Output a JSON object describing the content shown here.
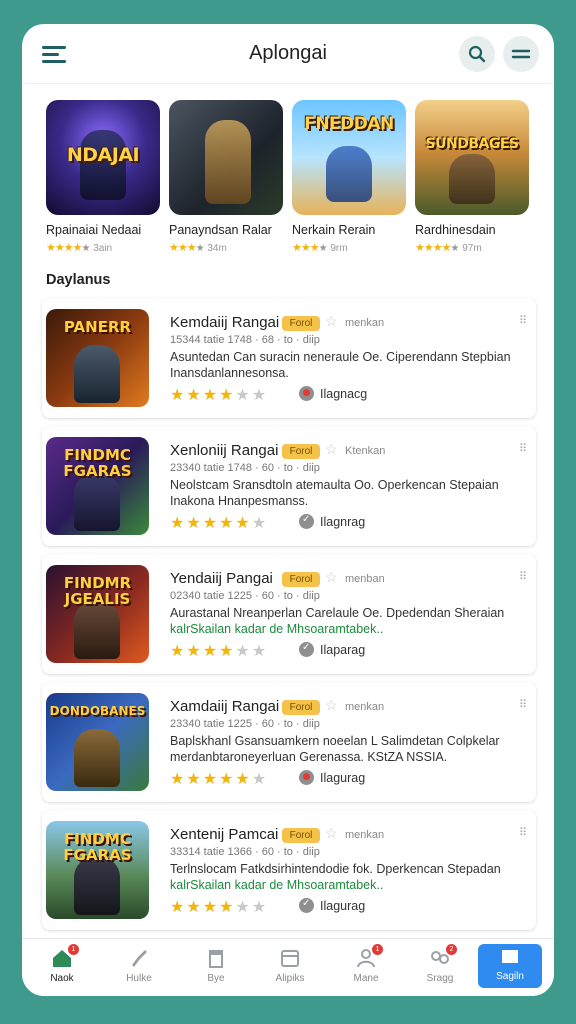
{
  "app": {
    "title": "Aplongai"
  },
  "featured": [
    {
      "name": "Rpainaiai Nedaai",
      "logo": "NDAJAI",
      "rating_text": "3ain",
      "stars": 4
    },
    {
      "name": "Panayndsan Ralar",
      "logo": "",
      "rating_text": "34m",
      "stars": 3
    },
    {
      "name": "Nerkain Rerain",
      "logo": "FNEDDAN",
      "rating_text": "9rm",
      "stars": 4
    },
    {
      "name": "Rardhinesdain",
      "logo": "SUNDBAGES",
      "rating_text": "97m",
      "stars": 4
    }
  ],
  "section": {
    "title": "Daylanus"
  },
  "apps": [
    {
      "name": "Kemdaiij Rangai",
      "logo": "PANERR",
      "badge": "Forol",
      "tag": "menkan",
      "meta": "15344 tatie 1748 · 68 · to · diip",
      "desc1": "Asuntedan Can suracin neneraule Oe. Ciperendann Stepbian",
      "desc2": "Inansdanlannesonsa.",
      "desc2_green": false,
      "stars": 4,
      "developer": "Ilagnacg",
      "dev_icon": "red"
    },
    {
      "name": "Xenloniij Rangai",
      "logo": "FINDMC FGARAS",
      "badge": "Forol",
      "tag": "Ktenkan",
      "meta": "23340 tatie 1748 · 60 · to · diip",
      "desc1": "Neolstcam Sransdtoln atemaulta Oo. Operkencan Stepaian",
      "desc2": "Inakona Hnanpesmanss.",
      "desc2_green": false,
      "stars": 5,
      "developer": "Ilagnrag",
      "dev_icon": "check"
    },
    {
      "name": "Yendaiij Pangai",
      "logo": "FINDMR JGEALIS",
      "badge": "Forol",
      "tag": "menban",
      "meta": "02340 tatie 1225 · 60 · to · diip",
      "desc1": "Aurastanal Nreanperlan Carelaule Oe. Dpedendan Sheraian",
      "desc2": "kalrSkailan kadar de Mhsoaramtabek..",
      "desc2_green": true,
      "stars": 4,
      "developer": "Ilaparag",
      "dev_icon": "check"
    },
    {
      "name": "Xamdaiij Rangai",
      "logo": "DONDOBANES",
      "badge": "Forol",
      "tag": "menkan",
      "meta": "23340 tatie 1225 · 60 · to · diip",
      "desc1": "Baplskhanl Gsansuamkern noeelan L Salimdetan Colpkelar",
      "desc2": "merdanbtaroneyerluan Gerenassa. KStZA NSSIA.",
      "desc2_green": false,
      "stars": 5,
      "developer": "Ilagurag",
      "dev_icon": "red"
    },
    {
      "name": "Xentenij Pamcai",
      "logo": "FINDMC FGARAS",
      "badge": "Forol",
      "tag": "menkan",
      "meta": "33314 tatie 1366 · 60 · to · diip",
      "desc1": "Terlnslocam Fatkdsirhintendodie fok. Dperkencan Stepadan",
      "desc2": "kalrSkailan kadar de Mhsoaramtabek..",
      "desc2_green": true,
      "stars": 4,
      "developer": "Ilagurag",
      "dev_icon": "check"
    }
  ],
  "nav": [
    {
      "label": "Naok",
      "icon": "home-icon",
      "badge": "1",
      "active": true
    },
    {
      "label": "Hulke",
      "icon": "rocket-icon",
      "badge": "",
      "active": false
    },
    {
      "label": "Bye",
      "icon": "trash-icon",
      "badge": "",
      "active": false
    },
    {
      "label": "Alipiks",
      "icon": "calendar-icon",
      "badge": "",
      "active": false
    },
    {
      "label": "Mane",
      "icon": "user-icon",
      "badge": "1",
      "active": false
    },
    {
      "label": "Sragg",
      "icon": "group-icon",
      "badge": "2",
      "active": false
    },
    {
      "label": "Sagiln",
      "icon": "square-icon",
      "badge": "",
      "active": false,
      "primary": true
    }
  ],
  "colors": {
    "background": "#3d9a8d",
    "accent": "#1f5f61",
    "star": "#f2b40f",
    "badge": "#f6c34a",
    "primary_nav": "#2f8bf0",
    "notify": "#e53935"
  }
}
